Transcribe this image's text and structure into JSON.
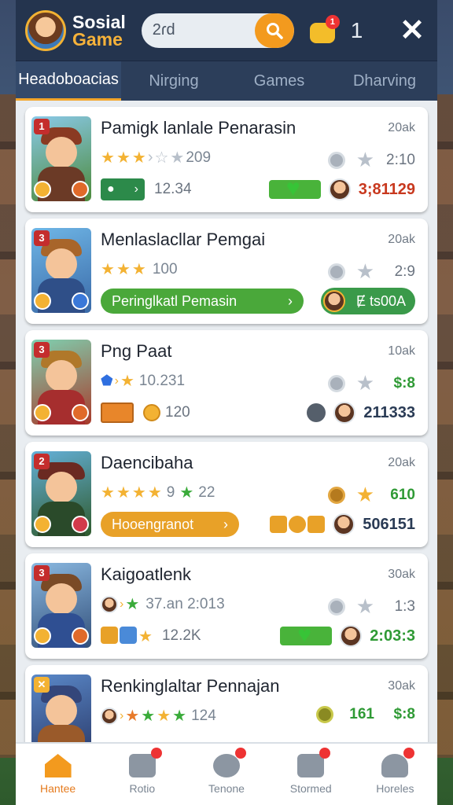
{
  "header": {
    "brand_line1": "Sosial",
    "brand_line2": "Game",
    "search_value": "2ɾd",
    "notif_badge": "1",
    "notif_count": "1"
  },
  "tabs": [
    {
      "label": "Headoboacias",
      "active": true
    },
    {
      "label": "Nirging",
      "active": false
    },
    {
      "label": "Games",
      "active": false
    },
    {
      "label": "Dharving",
      "active": false
    }
  ],
  "cards": [
    {
      "rank": "1",
      "title": "Pamigk lanlale Penarasin",
      "time": "20ak",
      "rating_text": "209",
      "stat_val": "2:10",
      "sub_value": "12.34",
      "score": "3;81129"
    },
    {
      "rank": "3",
      "title": "Menlaslacllar Pemgai",
      "time": "20ak",
      "rating_text": "100",
      "stat_val": "2:9",
      "action_label": "Peringlkatl  Pemasin",
      "user_pill_text": "Ɇ ts00A"
    },
    {
      "rank": "3",
      "title": "Png Paat",
      "time": "10ak",
      "rating_text": "10.231",
      "stat_val": "$:8",
      "badge_text": "",
      "sub_value": "120",
      "score": "211333"
    },
    {
      "rank": "2",
      "title": "Daencibaha",
      "time": "20ak",
      "rating_text": "22",
      "rating_mid": "9",
      "stat_val": "610",
      "action_label": "Hooengranot",
      "score": "506151"
    },
    {
      "rank": "3",
      "title": "Kaigoatlenk",
      "time": "30ak",
      "rating_text": "37.an  2:013",
      "stat_val": "1:3",
      "sub_value": "12.2K",
      "score": "2:03:3"
    },
    {
      "rank": "",
      "title": "Renkinglaltar Pennajan",
      "time": "30ak",
      "rating_text": "124",
      "stat_pre": "161",
      "stat_val": "$:8"
    }
  ],
  "bottom_nav": [
    {
      "label": "Hantee",
      "active": true
    },
    {
      "label": "Rotio",
      "active": false
    },
    {
      "label": "Tenone",
      "active": false
    },
    {
      "label": "Stormed",
      "active": false
    },
    {
      "label": "Horeles",
      "active": false
    }
  ],
  "colors": {
    "header_bg": "#24344e",
    "accent_orange": "#f39a1e",
    "action_green": "#4aa83a",
    "action_orange": "#e8a128"
  }
}
